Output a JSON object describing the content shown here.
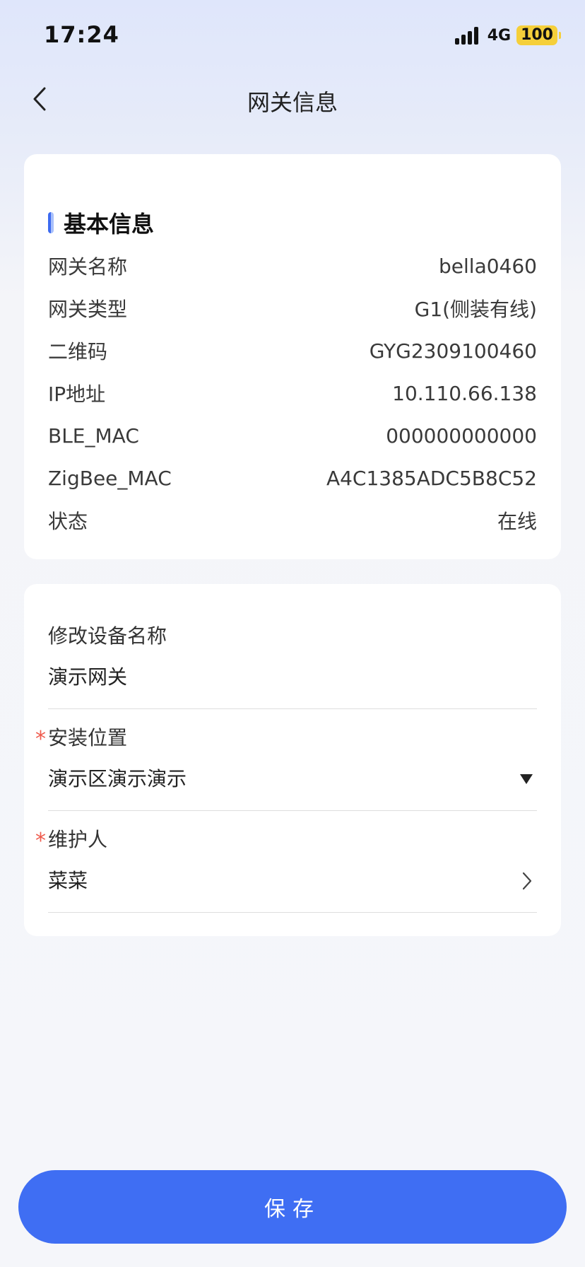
{
  "status_bar": {
    "time": "17:24",
    "network": "4G",
    "battery": "100"
  },
  "nav": {
    "title": "网关信息",
    "back_icon": "chevron-left-icon"
  },
  "basic_info": {
    "title": "基本信息",
    "rows": [
      {
        "label": "网关名称",
        "value": "bella0460"
      },
      {
        "label": "网关类型",
        "value": "G1(侧装有线)"
      },
      {
        "label": "二维码",
        "value": "GYG2309100460"
      },
      {
        "label": "IP地址",
        "value": "10.110.66.138"
      },
      {
        "label": "BLE_MAC",
        "value": "000000000000"
      },
      {
        "label": "ZigBee_MAC",
        "value": "A4C1385ADC5B8C52"
      },
      {
        "label": "状态",
        "value": "在线"
      }
    ]
  },
  "form": {
    "device_name": {
      "label": "修改设备名称",
      "value": "演示网关"
    },
    "install_location": {
      "label": "安装位置",
      "value": "演示区演示演示",
      "required_mark": "*"
    },
    "maintainer": {
      "label": "维护人",
      "value": "菜菜",
      "required_mark": "*"
    }
  },
  "save_label": "保存",
  "colors": {
    "accent": "#3f6ef3",
    "required": "#ef5a4c",
    "battery": "#f5cf3a"
  }
}
